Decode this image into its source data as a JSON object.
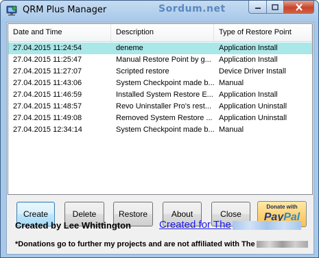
{
  "window": {
    "title": "QRM Plus Manager",
    "watermark": "Sordum.net"
  },
  "icons": {
    "app": "system-restore-monitor-icon",
    "minimize": "minimize-icon",
    "maximize": "maximize-icon",
    "close": "close-icon"
  },
  "listview": {
    "columns": [
      "Date and Time",
      "Description",
      "Type of Restore Point"
    ],
    "rows": [
      {
        "date": "27.04.2015 11:24:54",
        "description": "deneme",
        "type": "Application Install",
        "selected": true
      },
      {
        "date": "27.04.2015 11:25:47",
        "description": "Manual Restore Point by g...",
        "type": "Application Install",
        "selected": false
      },
      {
        "date": "27.04.2015 11:27:07",
        "description": "Scripted restore",
        "type": "Device Driver Install",
        "selected": false
      },
      {
        "date": "27.04.2015 11:43:06",
        "description": "System Checkpoint made b...",
        "type": "Manual",
        "selected": false
      },
      {
        "date": "27.04.2015 11:46:59",
        "description": "Installed System Restore E...",
        "type": "Application Install",
        "selected": false
      },
      {
        "date": "27.04.2015 11:48:57",
        "description": "Revo Uninstaller Pro's rest...",
        "type": "Application Uninstall",
        "selected": false
      },
      {
        "date": "27.04.2015 11:49:08",
        "description": "Removed System Restore ...",
        "type": "Application Uninstall",
        "selected": false
      },
      {
        "date": "27.04.2015 12:34:14",
        "description": "System Checkpoint made b...",
        "type": "Manual",
        "selected": false
      }
    ]
  },
  "buttons": {
    "create": "Create",
    "delete": "Delete",
    "restore": "Restore",
    "about": "About",
    "close": "Close"
  },
  "donate": {
    "label": "Donate with",
    "brand_pay": "Pay",
    "brand_pal": "Pal"
  },
  "footer": {
    "credit": "Created by Lee Whittington",
    "link": "Created for The",
    "note": "*Donations go to further my projects and are not affiliated with The"
  },
  "colors": {
    "selected_row": "#a9e7e8",
    "link": "#1a1aee",
    "title_bar": "#a8c8ea",
    "close_button": "#c7452b"
  }
}
